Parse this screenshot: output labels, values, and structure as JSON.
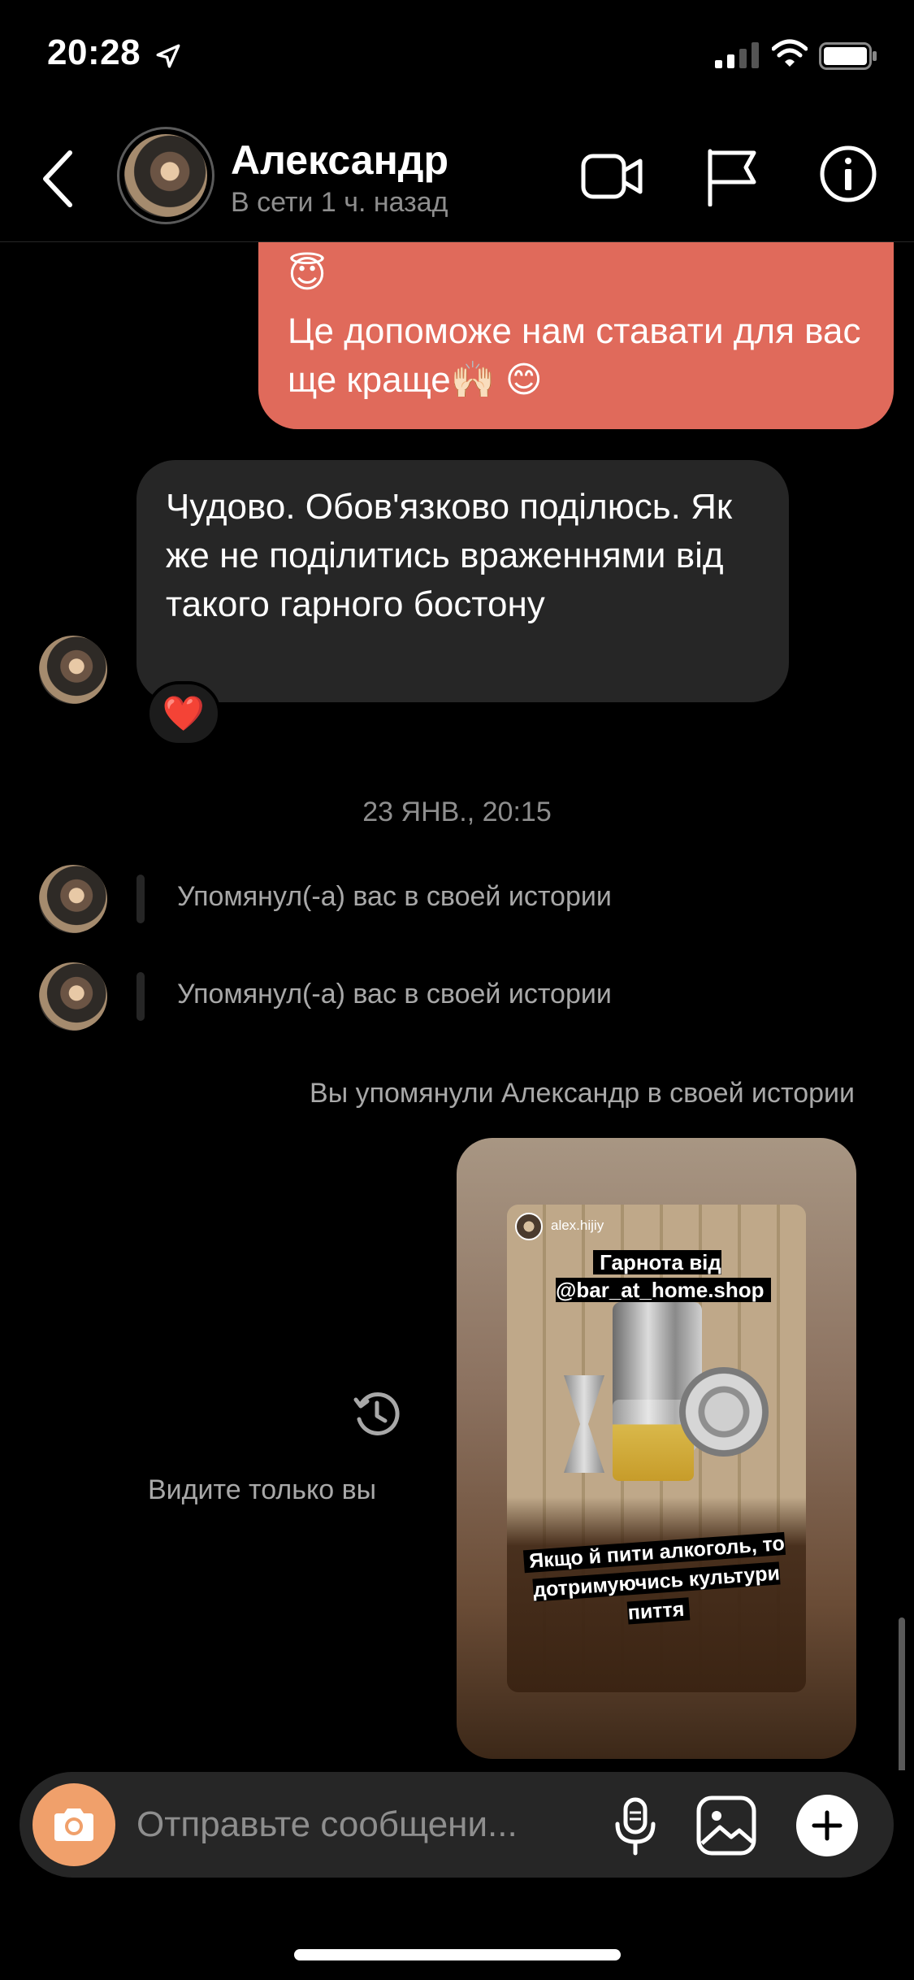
{
  "status_bar": {
    "time": "20:28"
  },
  "header": {
    "contact_name": "Александр",
    "contact_status": "В сети 1 ч. назад"
  },
  "messages": {
    "outgoing_emoji_line": "😇",
    "outgoing_text": "Це допоможе нам ставати для вас ще краще🙌🏻 😊",
    "incoming_text": "Чудово. Обов'язково поділюсь. Як же не поділитись враженнями від такого гарного бостону",
    "reaction": "❤️",
    "date_separator": "23 ЯНВ., 20:15",
    "mentions": [
      "Упомянул(-а) вас в своей истории",
      "Упомянул(-а) вас в своей истории"
    ],
    "you_mentioned": "Вы упомянули Александр в своей истории",
    "story": {
      "username": "alex.hijiy",
      "sticker_top": "Гарнота від @bar_at_home.shop",
      "sticker_bottom": "Якщо й пити алкоголь, то дотримуючись культури пиття"
    },
    "only_you_label": "Видите только вы"
  },
  "composer": {
    "placeholder": "Отправьте сообщени..."
  },
  "icons": {
    "back": "chevron-left-icon",
    "video": "video-camera-icon",
    "flag": "flag-icon",
    "info": "info-icon",
    "camera": "camera-icon",
    "mic": "microphone-icon",
    "gallery": "gallery-icon",
    "plus": "plus-icon",
    "history": "history-icon"
  },
  "colors": {
    "outgoing_bubble": "#e06a5b",
    "incoming_bubble": "#262626",
    "camera_button": "#f0a06b",
    "background": "#000000"
  }
}
